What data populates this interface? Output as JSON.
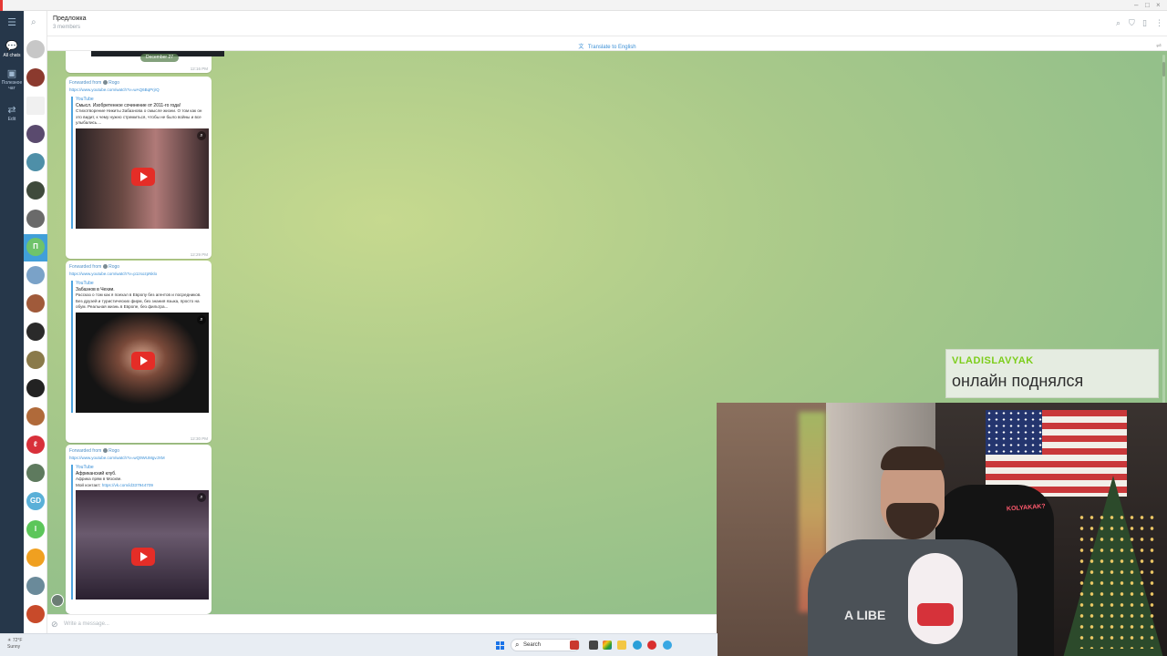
{
  "window": {
    "controls": [
      "–",
      "□",
      "×"
    ]
  },
  "folders": [
    {
      "label": "All chats",
      "icon": "chat-bubbles-icon",
      "badge": "",
      "active": true
    },
    {
      "label": "Полезное чат",
      "icon": "folder-icon",
      "badge": "",
      "active": false
    },
    {
      "label": "Edit",
      "icon": "sliders-icon",
      "badge": "",
      "active": false
    }
  ],
  "header": {
    "title": "Предложка",
    "subtitle": "3 members"
  },
  "translate_bar": {
    "label": "Translate to English"
  },
  "date_pill": "December 27",
  "messages": [
    {
      "forwarded_from": "Forwarded from",
      "sender": "Rogo",
      "link": "https://www.youtube.com/watch?v=wAQ6BqPrjrQ",
      "site": "YouTube",
      "title": "Смысл. Изобретенное сочинение от 2011-го года!",
      "desc": "Стихотворение Никиты Забазнова о смысле жизни. О том как он это видит, к чему нужно стремиться, чтобы не было войны и все улыбались....",
      "time": "12:29 PM"
    },
    {
      "forwarded_from": "Forwarded from",
      "sender": "Rogo",
      "link": "https://www.youtube.com/watch?v=p1zsozpNklo",
      "site": "YouTube",
      "title": "Забазнов в Чехии.",
      "desc": "Рассказ о том как я поехал в Европу без агентов и посредников. Без друзей и туристических фирм, без знания языка, просто на обум. Реальная жизнь в Европе, без фильтра...",
      "time": "12:30 PM"
    },
    {
      "forwarded_from": "Forwarded from",
      "sender": "Rogo",
      "link": "https://www.youtube.com/watch?v=wQ9WUMgvJXM",
      "site": "YouTube",
      "title": "Африканский клуб.",
      "desc": "Африка прям в Москве.",
      "contact_label": "Мой контакт:",
      "contact_link": "https://vk.com/id337944709",
      "time": ""
    }
  ],
  "composer": {
    "placeholder": "Write a message..."
  },
  "stream_alert": {
    "username": "VLADISLAVYAK",
    "message": "онлайн поднялся"
  },
  "webcam": {
    "shirt_text": "A LIBE",
    "neon_sign": "KOLYAKAK?"
  },
  "taskbar": {
    "weather_temp": "72°F",
    "weather_desc": "Sunny",
    "search_label": "Search"
  },
  "colors": {
    "folder_rail": "#26374a",
    "accent": "#419fd9",
    "alert_username": "#7ccd1a",
    "play_button": "#e52d27"
  }
}
